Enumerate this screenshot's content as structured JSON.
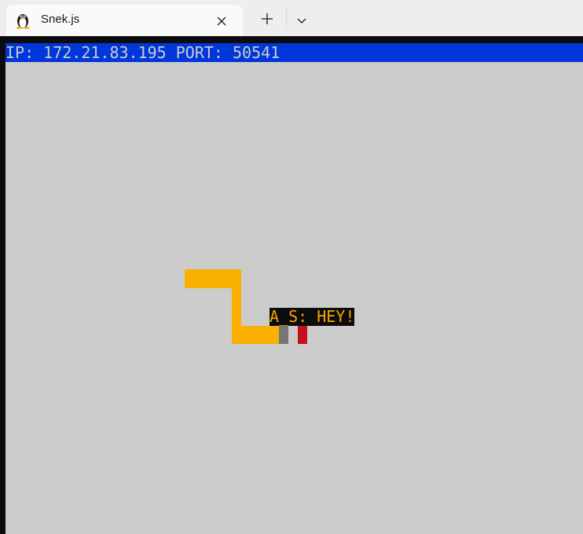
{
  "tab": {
    "title": "Snek.js",
    "icon": "tux-penguin-icon"
  },
  "status_bar": {
    "text": "IP: 172.21.83.195 PORT: 50541",
    "color": "#0037da"
  },
  "game": {
    "background_color": "#cccccc",
    "snake_color": "#f9b000",
    "player_label": "A_S: HEY!",
    "items": [
      {
        "name": "gray-block",
        "color": "#767676"
      },
      {
        "name": "red-food",
        "color": "#c50f1f"
      }
    ]
  }
}
